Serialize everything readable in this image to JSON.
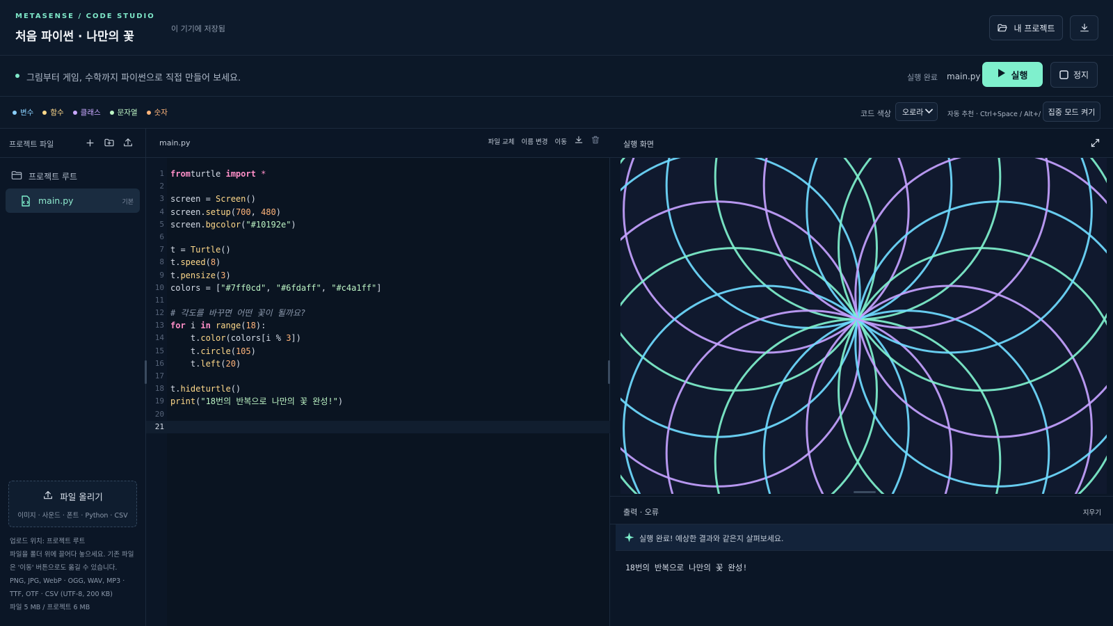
{
  "header": {
    "brand": "METASENSE / CODE STUDIO",
    "project_title": "처음 파이썬 · 나만의 꽃",
    "saved_note": "이 기기에 저장됨",
    "my_projects_label": "내 프로젝트"
  },
  "banner": {
    "text": "그림부터 게임, 수학까지 파이썬으로 직접 만들어 보세요.",
    "run_status": "실행 완료",
    "current_file": "main.py",
    "run_label": "실행",
    "stop_label": "정지"
  },
  "toolbar": {
    "legend": [
      {
        "label": "변수",
        "color": "#8ad0ff"
      },
      {
        "label": "함수",
        "color": "#ffd98a"
      },
      {
        "label": "클래스",
        "color": "#c9a8ff"
      },
      {
        "label": "문자열",
        "color": "#bdf5c5"
      },
      {
        "label": "숫자",
        "color": "#ffb47a"
      }
    ],
    "code_color_label": "코드 색상",
    "theme_value": "오로라",
    "autocomplete_hint": "자동 추천 · Ctrl+Space / Alt+/",
    "focus_mode_label": "집중 모드 켜기"
  },
  "sidebar": {
    "title": "프로젝트 파일",
    "root_label": "프로젝트 루트",
    "file_name": "main.py",
    "file_badge": "기본",
    "upload_label": "파일 올리기",
    "upload_types": "이미지 · 사운드 · 폰트 · Python · CSV",
    "upload_info": [
      "업로드 위치: 프로젝트 루트",
      "파일을 폴더 위에 끌어다 놓으세요. 기존 파일",
      "은 '이동' 버튼으로도 옮길 수 있습니다.",
      "PNG, JPG, WebP · OGG, WAV, MP3 ·",
      "TTF, OTF · CSV (UTF-8, 200 KB)",
      "파일 5 MB / 프로젝트 6 MB"
    ]
  },
  "editor": {
    "tab": "main.py",
    "actions": {
      "replace": "파일 교체",
      "rename": "이름 변경",
      "move": "이동"
    },
    "active_line": 21,
    "lines": [
      {
        "n": "1",
        "t": [
          [
            "kw",
            "from"
          ],
          [
            "",
            "turtle "
          ],
          [
            "kw",
            "import"
          ],
          [
            "op",
            " *"
          ]
        ]
      },
      {
        "n": "2",
        "t": []
      },
      {
        "n": "3",
        "t": [
          [
            "",
            "screen = "
          ],
          [
            "fn",
            "Screen"
          ],
          [
            "",
            "()"
          ]
        ]
      },
      {
        "n": "4",
        "t": [
          [
            "",
            "screen."
          ],
          [
            "fn",
            "setup"
          ],
          [
            "",
            "("
          ],
          [
            "nu",
            "700"
          ],
          [
            "",
            ", "
          ],
          [
            "nu",
            "480"
          ],
          [
            "",
            ")"
          ]
        ]
      },
      {
        "n": "5",
        "t": [
          [
            "",
            "screen."
          ],
          [
            "fn",
            "bgcolor"
          ],
          [
            "",
            "("
          ],
          [
            "st",
            "\"#10192e\""
          ],
          [
            "",
            ")"
          ]
        ]
      },
      {
        "n": "6",
        "t": []
      },
      {
        "n": "7",
        "t": [
          [
            "",
            "t = "
          ],
          [
            "fn",
            "Turtle"
          ],
          [
            "",
            "()"
          ]
        ]
      },
      {
        "n": "8",
        "t": [
          [
            "",
            "t."
          ],
          [
            "fn",
            "speed"
          ],
          [
            "",
            "("
          ],
          [
            "nu",
            "8"
          ],
          [
            "",
            ")"
          ]
        ]
      },
      {
        "n": "9",
        "t": [
          [
            "",
            "t."
          ],
          [
            "fn",
            "pensize"
          ],
          [
            "",
            "("
          ],
          [
            "nu",
            "3"
          ],
          [
            "",
            ")"
          ]
        ]
      },
      {
        "n": "10",
        "t": [
          [
            "",
            "colors = ["
          ],
          [
            "st",
            "\"#7ff0cd\""
          ],
          [
            "",
            ", "
          ],
          [
            "st",
            "\"#6fdaff\""
          ],
          [
            "",
            ", "
          ],
          [
            "st",
            "\"#c4a1ff\""
          ],
          [
            "",
            "]"
          ]
        ]
      },
      {
        "n": "11",
        "t": []
      },
      {
        "n": "12",
        "t": [
          [
            "cm",
            "# 각도를 바꾸면 어떤 꽃이 될까요?"
          ]
        ]
      },
      {
        "n": "13",
        "t": [
          [
            "kw",
            "for"
          ],
          [
            "",
            " i "
          ],
          [
            "kw",
            "in"
          ],
          [
            "",
            ""
          ],
          [
            "fn",
            " range"
          ],
          [
            "",
            "("
          ],
          [
            "nu",
            "18"
          ],
          [
            "",
            "):"
          ]
        ]
      },
      {
        "n": "14",
        "t": [
          [
            "",
            "    t."
          ],
          [
            "fn",
            "color"
          ],
          [
            "",
            "(colors[i % "
          ],
          [
            "nu",
            "3"
          ],
          [
            "",
            "])"
          ]
        ]
      },
      {
        "n": "15",
        "t": [
          [
            "",
            "    t."
          ],
          [
            "fn",
            "circle"
          ],
          [
            "",
            "("
          ],
          [
            "nu",
            "105"
          ],
          [
            "",
            ")"
          ]
        ]
      },
      {
        "n": "16",
        "t": [
          [
            "",
            "    t."
          ],
          [
            "fn",
            "left"
          ],
          [
            "",
            "("
          ],
          [
            "nu",
            "20"
          ],
          [
            "",
            ")"
          ]
        ]
      },
      {
        "n": "17",
        "t": []
      },
      {
        "n": "18",
        "t": [
          [
            "",
            "t."
          ],
          [
            "fn",
            "hideturtle"
          ],
          [
            "",
            "()"
          ]
        ]
      },
      {
        "n": "19",
        "t": [
          [
            "fn",
            "print"
          ],
          [
            "",
            "("
          ],
          [
            "st",
            "\"18번의 반복으로 나만의 꽃 완성!\""
          ],
          [
            "",
            ")"
          ]
        ]
      },
      {
        "n": "20",
        "t": []
      },
      {
        "n": "21",
        "t": []
      }
    ]
  },
  "output": {
    "title": "실행 화면",
    "canvas": {
      "bg": "#10192e",
      "circle_count": 18,
      "radius": 105,
      "turn_deg": 20,
      "pen_size": 3,
      "colors": [
        "#7ff0cd",
        "#6fdaff",
        "#c4a1ff"
      ]
    },
    "console_title": "출력 · 오류",
    "clear_label": "지우기",
    "console_banner": "실행 완료! 예상한 결과와 같은지 살펴보세요.",
    "console_output": "18번의 반복으로 나만의 꽃 완성!"
  }
}
